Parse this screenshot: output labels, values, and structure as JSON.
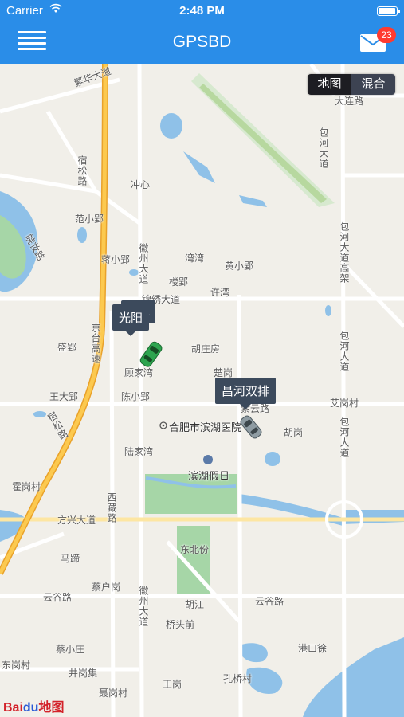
{
  "status_bar": {
    "carrier": "Carrier",
    "time": "2:48 PM"
  },
  "nav": {
    "title": "GPSBD",
    "badge_count": "23",
    "menu_icon": "hamburger-menu-icon",
    "mail_icon": "envelope-icon"
  },
  "map_type": {
    "map_label": "地图",
    "hybrid_label": "混合",
    "selected": "地图"
  },
  "vehicles": [
    {
      "name": "光阳",
      "color": "#2ea44f"
    },
    {
      "name": "昌河双排",
      "color": "#8f9ca3"
    }
  ],
  "hidden_tag_fragment": "f1",
  "map_labels": {
    "fanhua": "繁华大道",
    "dalian": "大连路",
    "baohe_n": "包河大道",
    "suosong": "宿松路",
    "chongxin": "冲心",
    "fanxiaoying": "范小郢",
    "wanxian": "皖妆路",
    "baohe_high": "包河大道高架",
    "huizhou_n": "徽州大道",
    "xiaoying": "蒋小郢",
    "wan": "湾湾",
    "huangxiaoying": "黄小郢",
    "louying": "楼郢",
    "xuwan": "许湾",
    "jinkuo": "锦绣大道",
    "jingtai": "京台高速",
    "shengying": "盛郢",
    "guzhuangfang": "胡庄房",
    "chugang": "楚岗",
    "gujiawan": "顾家湾",
    "baohe_s": "包河大道",
    "wangdaying": "王大郢",
    "chenxiaoying": "陈小郢",
    "ziyun": "紫云路",
    "aigang": "艾岗村",
    "hugang": "胡岗",
    "suosong_s": "宿松路",
    "hospital": "合肥市滨湖医院",
    "lujiawan": "陆家湾",
    "binhu": "滨湖假日",
    "huogang": "霍岗村",
    "xizang": "西藏路",
    "fangxing": "方兴大道",
    "mati": "马蹄",
    "dongbei": "东北份",
    "caihu": "蔡户岗",
    "yungu_w": "云谷路",
    "huizhou_s": "徽州大道",
    "hujiang": "胡江",
    "qiaotou": "桥头前",
    "yungu_e": "云谷路",
    "baohe_se": "包河大道",
    "gangkou": "港口徐",
    "caixiaozhuang": "蔡小庄",
    "jinggangji": "井岗集",
    "donggang": "东岗村",
    "niegang": "聂岗村",
    "wanggang": "王岗",
    "kongqiao": "孔桥村"
  },
  "brand": {
    "bai": "Bai",
    "paw": "du",
    "ditu": "地图"
  }
}
